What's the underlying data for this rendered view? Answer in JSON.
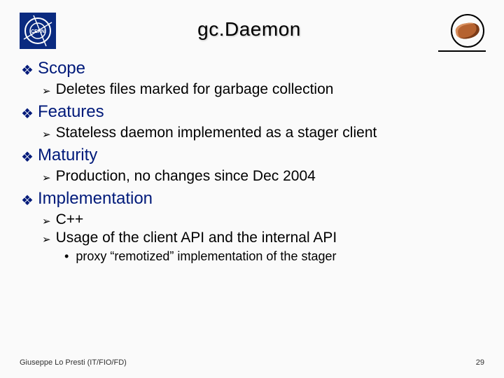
{
  "title": "gc.Daemon",
  "logo_left_name": "cern-logo",
  "logo_right_name": "castor-logo",
  "sections": [
    {
      "heading": "Scope",
      "items": [
        {
          "text": "Deletes files marked for garbage collection"
        }
      ]
    },
    {
      "heading": "Features",
      "items": [
        {
          "text": "Stateless daemon implemented as a stager client"
        }
      ]
    },
    {
      "heading": "Maturity",
      "items": [
        {
          "text": "Production, no changes since Dec 2004"
        }
      ]
    },
    {
      "heading": "Implementation",
      "items": [
        {
          "text": "C++"
        },
        {
          "text": "Usage of the client API and the internal API",
          "sub": [
            {
              "text": "proxy “remotized” implementation of the stager"
            }
          ]
        }
      ]
    }
  ],
  "footer": {
    "author": "Giuseppe Lo Presti (IT/FIO/FD)",
    "page": "29"
  },
  "glyphs": {
    "diamond": "❖",
    "chevron": "➢",
    "dot": "•"
  }
}
